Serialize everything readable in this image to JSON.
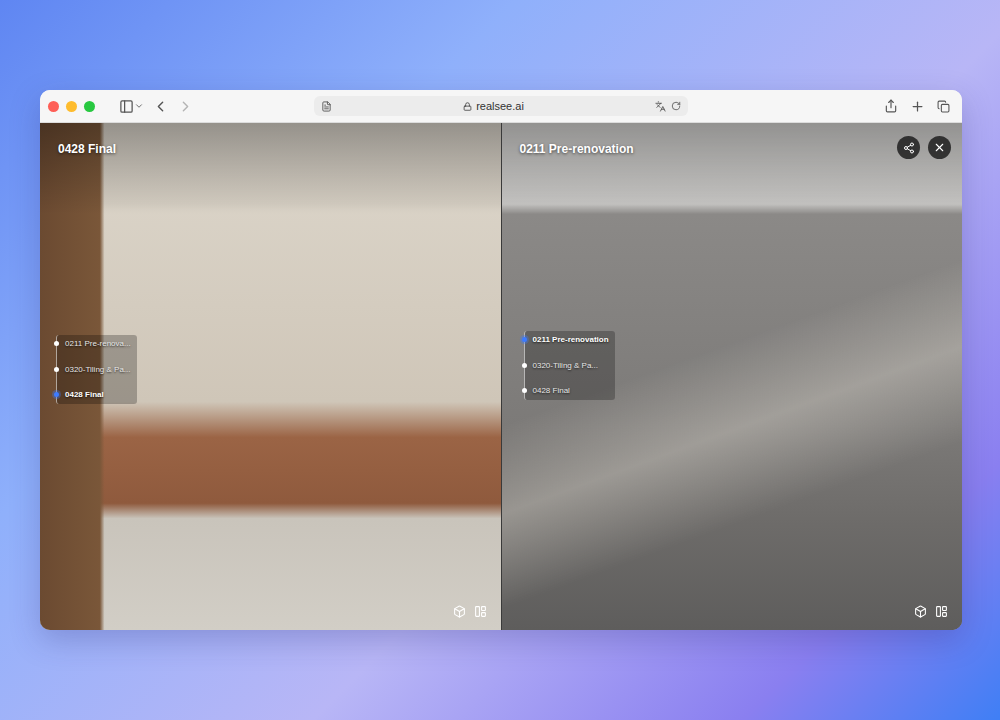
{
  "browser": {
    "url": "realsee.ai"
  },
  "panes": [
    {
      "title": "0428 Final",
      "kind": "final",
      "closable": false,
      "timeline": [
        {
          "label": "0211 Pre-renova...",
          "selected": false
        },
        {
          "label": "0320-Tiling & Pa...",
          "selected": false
        },
        {
          "label": "0428 Final",
          "selected": true
        }
      ]
    },
    {
      "title": "0211 Pre-renovation",
      "kind": "bare",
      "closable": true,
      "timeline": [
        {
          "label": "0211 Pre-renovation",
          "selected": true
        },
        {
          "label": "0320-Tiling & Pa...",
          "selected": false
        },
        {
          "label": "0428 Final",
          "selected": false
        }
      ]
    }
  ]
}
